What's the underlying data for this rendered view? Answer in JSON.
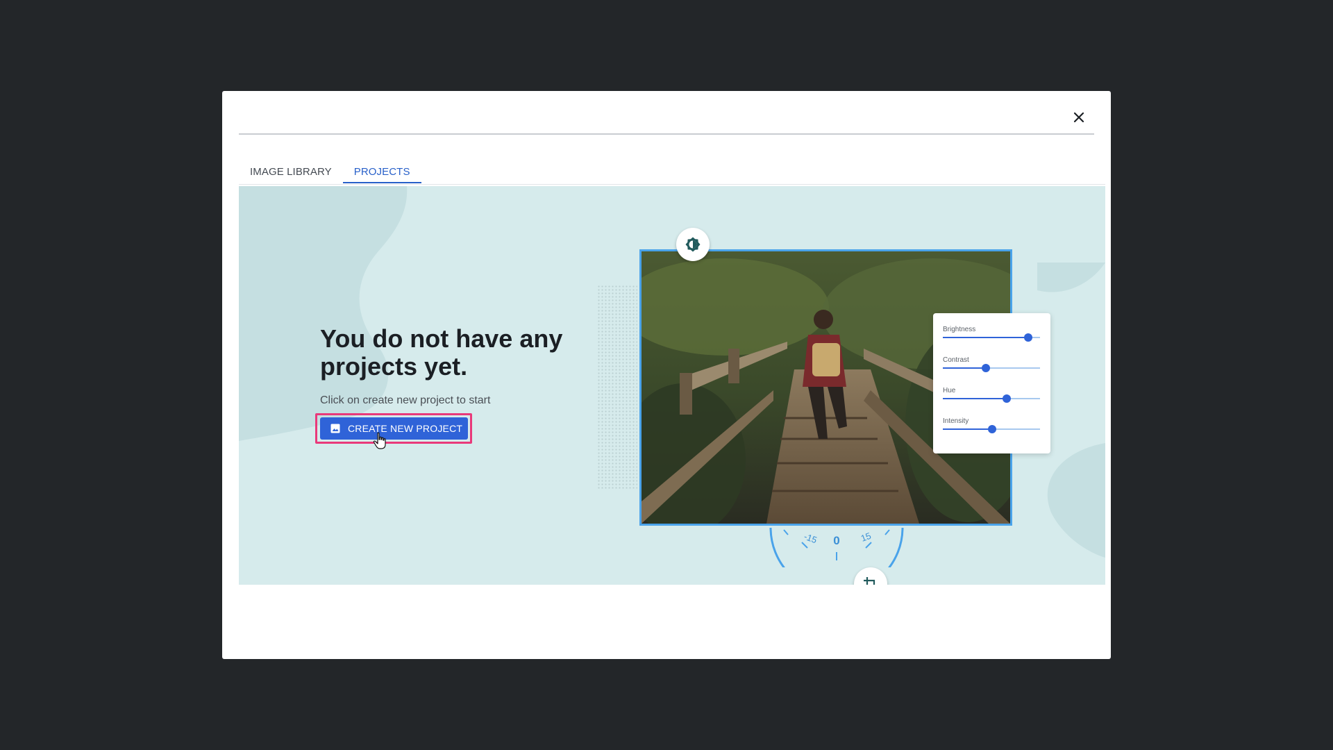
{
  "dialog": {
    "close_icon": "close-icon",
    "tabs": [
      {
        "label": "IMAGE LIBRARY",
        "active": false
      },
      {
        "label": "PROJECTS",
        "active": true
      }
    ]
  },
  "empty_state": {
    "headline": "You do not have any projects yet.",
    "subtext": "Click on create new project to start",
    "cta_label": "CREATE NEW PROJECT",
    "cta_icon": "image-icon"
  },
  "illustration": {
    "brightness_icon": "brightness-icon",
    "crop_icon": "crop-icon",
    "sliders": [
      {
        "label": "Brightness",
        "value": 0.88
      },
      {
        "label": "Contrast",
        "value": 0.44
      },
      {
        "label": "Hue",
        "value": 0.66
      },
      {
        "label": "Intensity",
        "value": 0.51
      }
    ],
    "rotation_dial": {
      "left_label": "-15",
      "center_label": "0",
      "right_label": "15"
    }
  },
  "colors": {
    "overlay": "#232629",
    "accent": "#2f63d8",
    "highlight": "#e9397a",
    "hero_bg": "#d6ebec",
    "frame": "#4aa3ea"
  }
}
